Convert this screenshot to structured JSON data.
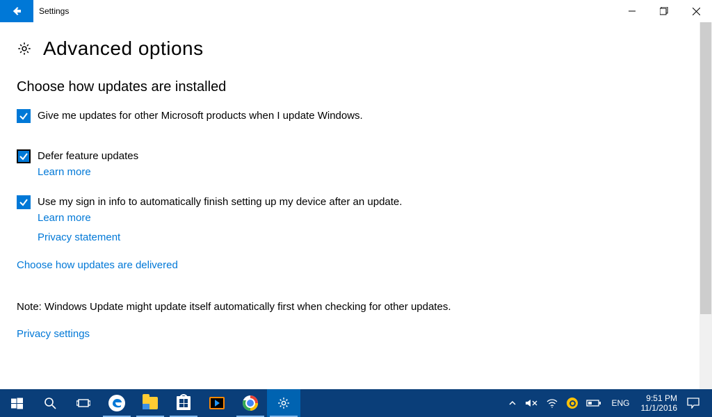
{
  "titlebar": {
    "title": "Settings"
  },
  "page": {
    "title": "Advanced options",
    "section_title": "Choose how updates are installed",
    "check_other_products": "Give me updates for other Microsoft products when I update Windows.",
    "check_defer": "Defer feature updates",
    "learn_more_defer": "Learn more",
    "check_signin": "Use my sign in info to automatically finish setting up my device after an update.",
    "learn_more_signin": "Learn more",
    "privacy_statement": "Privacy statement",
    "choose_delivered": "Choose how updates are delivered",
    "note_text": "Note: Windows Update might update itself automatically first when checking for other updates.",
    "privacy_settings": "Privacy settings"
  },
  "taskbar": {
    "language": "ENG",
    "time": "9:51 PM",
    "date": "11/1/2016"
  }
}
